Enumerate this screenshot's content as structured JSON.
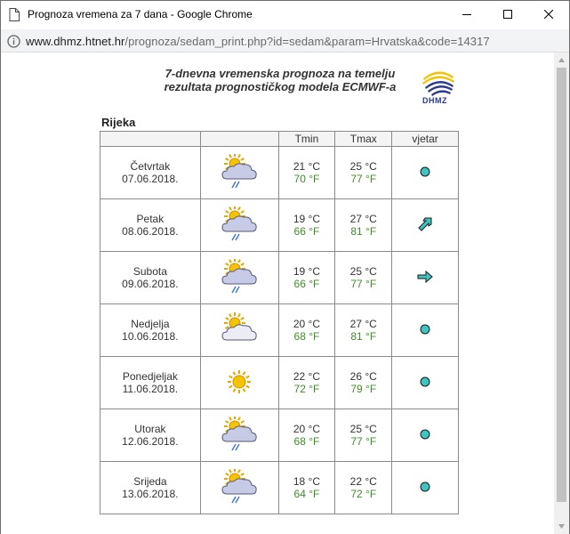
{
  "window": {
    "title": "Prognoza vremena za 7 dana - Google Chrome"
  },
  "address": {
    "host": "www.dhmz.htnet.hr",
    "path": "/prognoza/sedam_print.php?id=sedam&param=Hrvatska&code=14317"
  },
  "header": {
    "line1": "7-dnevna vremenska prognoza na temelju",
    "line2": "rezultata prognostičkog modela ECMWF-a",
    "logo_text": "DHMZ"
  },
  "city": "Rijeka",
  "table": {
    "headers": [
      "",
      "",
      "Tmin",
      "Tmax",
      "vjetar"
    ],
    "rows": [
      {
        "day": "Četvrtak",
        "date": "07.06.2018.",
        "icon": "sun-cloud-rain-icon",
        "tmin_c": "21 °C",
        "tmin_f": "70 °F",
        "tmax_c": "25 °C",
        "tmax_f": "77 °F",
        "wind": "calm-dot-icon"
      },
      {
        "day": "Petak",
        "date": "08.06.2018.",
        "icon": "sun-cloud-rain-icon",
        "tmin_c": "19 °C",
        "tmin_f": "66 °F",
        "tmax_c": "27 °C",
        "tmax_f": "81 °F",
        "wind": "wind-arrow-northeast-icon"
      },
      {
        "day": "Subota",
        "date": "09.06.2018.",
        "icon": "sun-cloud-rain-icon",
        "tmin_c": "19 °C",
        "tmin_f": "66 °F",
        "tmax_c": "25 °C",
        "tmax_f": "77 °F",
        "wind": "wind-arrow-east-icon"
      },
      {
        "day": "Nedjelja",
        "date": "10.06.2018.",
        "icon": "sun-cloud-icon",
        "tmin_c": "20 °C",
        "tmin_f": "68 °F",
        "tmax_c": "27 °C",
        "tmax_f": "81 °F",
        "wind": "calm-dot-icon"
      },
      {
        "day": "Ponedjeljak",
        "date": "11.06.2018.",
        "icon": "sun-icon",
        "tmin_c": "22 °C",
        "tmin_f": "72 °F",
        "tmax_c": "26 °C",
        "tmax_f": "79 °F",
        "wind": "calm-dot-icon"
      },
      {
        "day": "Utorak",
        "date": "12.06.2018.",
        "icon": "sun-cloud-rain-icon",
        "tmin_c": "20 °C",
        "tmin_f": "68 °F",
        "tmax_c": "25 °C",
        "tmax_f": "77 °F",
        "wind": "calm-dot-icon"
      },
      {
        "day": "Srijeda",
        "date": "13.06.2018.",
        "icon": "sun-cloud-rain-icon",
        "tmin_c": "18 °C",
        "tmin_f": "64 °F",
        "tmax_c": "22 °C",
        "tmax_f": "72 °F",
        "wind": "calm-dot-icon"
      }
    ]
  },
  "colors": {
    "fahrenheit": "#3f8c27",
    "wind_icon_fill": "#3fc4c4",
    "sun": "#f5c400",
    "cloud": "#c7cbe6"
  }
}
